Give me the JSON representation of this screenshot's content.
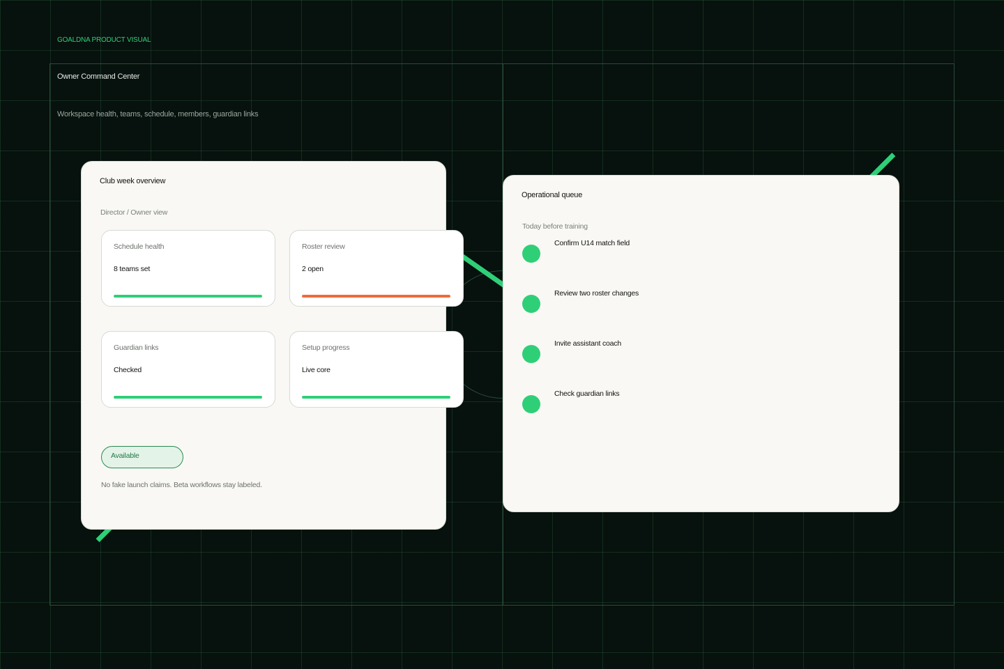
{
  "eyebrow": "GOALDNA PRODUCT VISUAL",
  "header": {
    "title": "Owner Command Center",
    "subtitle": "Workspace health, teams, schedule, members, guardian links"
  },
  "colors": {
    "accent": "#2fcf78",
    "warning": "#f06a3a",
    "background": "#07110d",
    "panel": "#f9f8f4"
  },
  "overview": {
    "title": "Club week overview",
    "subtitle": "Director / Owner view",
    "cards": [
      {
        "label": "Schedule health",
        "value": "8 teams set",
        "status": "ok"
      },
      {
        "label": "Roster review",
        "value": "2 open",
        "status": "warning"
      },
      {
        "label": "Guardian links",
        "value": "Checked",
        "status": "ok"
      },
      {
        "label": "Setup progress",
        "value": "Live core",
        "status": "ok"
      }
    ],
    "badge": "Available",
    "footnote": "No fake launch claims. Beta workflows stay labeled."
  },
  "queue": {
    "title": "Operational queue",
    "subtitle": "Today before training",
    "items": [
      {
        "label": "Confirm U14 match field"
      },
      {
        "label": "Review two roster changes"
      },
      {
        "label": "Invite assistant coach"
      },
      {
        "label": "Check guardian links"
      }
    ]
  }
}
